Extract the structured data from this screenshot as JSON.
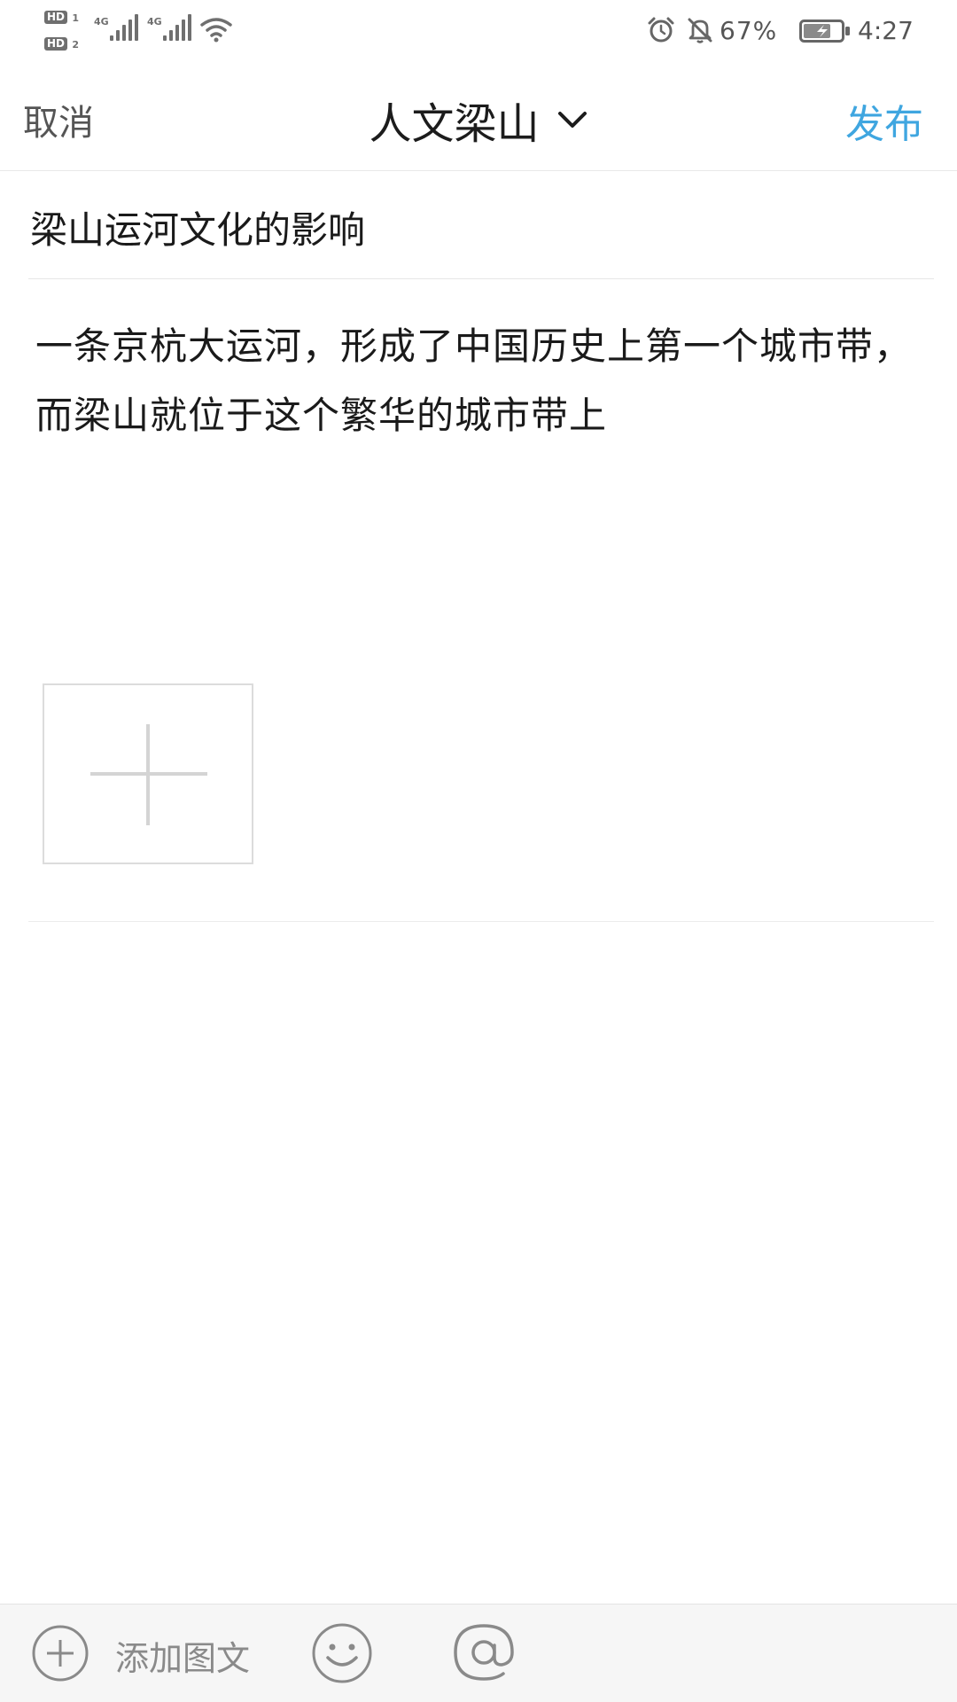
{
  "status_bar": {
    "hd1": "HD",
    "hd1_sub": "1",
    "hd2": "HD",
    "hd2_sub": "2",
    "net1": "4G",
    "net2": "4G",
    "battery_percent": "67%",
    "time": "4:27",
    "icons": [
      "signal-icon",
      "wifi-icon",
      "alarm-icon",
      "bell-off-icon",
      "battery-charging-icon"
    ]
  },
  "header": {
    "cancel_label": "取消",
    "title": "人文梁山",
    "publish_label": "发布",
    "accent_color": "#3fa6e0"
  },
  "post": {
    "title": "梁山运河文化的影响",
    "body": "一条京杭大运河，形成了中国历史上第一个城市带，而梁山就位于这个繁华的城市带上"
  },
  "toolbar": {
    "add_label": "添加图文",
    "icons": [
      "plus-circle-icon",
      "emoji-icon",
      "at-icon"
    ]
  }
}
